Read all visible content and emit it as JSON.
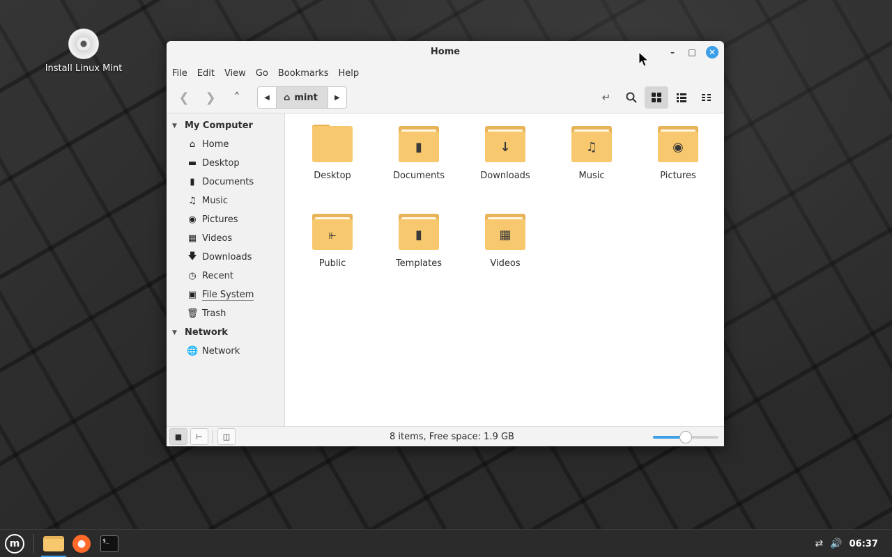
{
  "desktop": {
    "icons": [
      {
        "label": "Install Linux Mint",
        "icon": "disc-icon"
      }
    ]
  },
  "window": {
    "title": "Home",
    "menu": [
      "File",
      "Edit",
      "View",
      "Go",
      "Bookmarks",
      "Help"
    ],
    "path": {
      "current": "mint"
    },
    "sidebar": {
      "sections": [
        {
          "label": "My Computer",
          "items": [
            {
              "label": "Home",
              "icon": "home-icon"
            },
            {
              "label": "Desktop",
              "icon": "desktop-icon"
            },
            {
              "label": "Documents",
              "icon": "document-icon"
            },
            {
              "label": "Music",
              "icon": "music-icon"
            },
            {
              "label": "Pictures",
              "icon": "camera-icon"
            },
            {
              "label": "Videos",
              "icon": "film-icon"
            },
            {
              "label": "Downloads",
              "icon": "download-icon"
            },
            {
              "label": "Recent",
              "icon": "clock-icon"
            },
            {
              "label": "File System",
              "icon": "drive-icon"
            },
            {
              "label": "Trash",
              "icon": "trash-icon"
            }
          ]
        },
        {
          "label": "Network",
          "items": [
            {
              "label": "Network",
              "icon": "globe-icon"
            }
          ]
        }
      ]
    },
    "files": [
      {
        "name": "Desktop",
        "icon": "folder-icon"
      },
      {
        "name": "Documents",
        "icon": "folder-document-icon"
      },
      {
        "name": "Downloads",
        "icon": "folder-download-icon"
      },
      {
        "name": "Music",
        "icon": "folder-music-icon"
      },
      {
        "name": "Pictures",
        "icon": "folder-camera-icon"
      },
      {
        "name": "Public",
        "icon": "folder-share-icon"
      },
      {
        "name": "Templates",
        "icon": "folder-template-icon"
      },
      {
        "name": "Videos",
        "icon": "folder-film-icon"
      }
    ],
    "status": "8 items, Free space: 1.9 GB",
    "zoom_level": 0.5
  },
  "taskbar": {
    "apps": [
      "files",
      "firefox",
      "terminal"
    ],
    "clock": "06:37"
  },
  "colors": {
    "accent": "#3b9ee6",
    "folder": "#f8c86e",
    "folder_dark": "#e8b45a"
  }
}
